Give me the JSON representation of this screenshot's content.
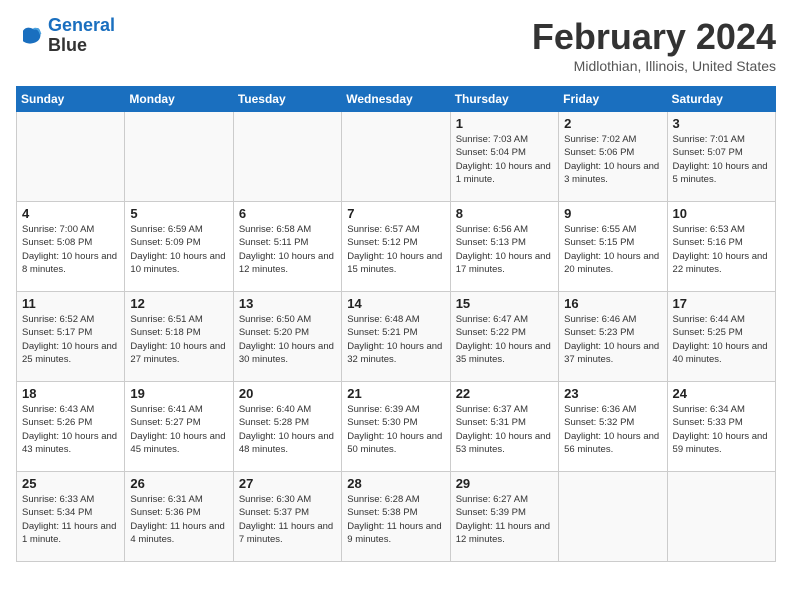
{
  "header": {
    "logo_line1": "General",
    "logo_line2": "Blue",
    "title": "February 2024",
    "subtitle": "Midlothian, Illinois, United States"
  },
  "weekdays": [
    "Sunday",
    "Monday",
    "Tuesday",
    "Wednesday",
    "Thursday",
    "Friday",
    "Saturday"
  ],
  "weeks": [
    [
      {
        "num": "",
        "detail": ""
      },
      {
        "num": "",
        "detail": ""
      },
      {
        "num": "",
        "detail": ""
      },
      {
        "num": "",
        "detail": ""
      },
      {
        "num": "1",
        "detail": "Sunrise: 7:03 AM\nSunset: 5:04 PM\nDaylight: 10 hours\nand 1 minute."
      },
      {
        "num": "2",
        "detail": "Sunrise: 7:02 AM\nSunset: 5:06 PM\nDaylight: 10 hours\nand 3 minutes."
      },
      {
        "num": "3",
        "detail": "Sunrise: 7:01 AM\nSunset: 5:07 PM\nDaylight: 10 hours\nand 5 minutes."
      }
    ],
    [
      {
        "num": "4",
        "detail": "Sunrise: 7:00 AM\nSunset: 5:08 PM\nDaylight: 10 hours\nand 8 minutes."
      },
      {
        "num": "5",
        "detail": "Sunrise: 6:59 AM\nSunset: 5:09 PM\nDaylight: 10 hours\nand 10 minutes."
      },
      {
        "num": "6",
        "detail": "Sunrise: 6:58 AM\nSunset: 5:11 PM\nDaylight: 10 hours\nand 12 minutes."
      },
      {
        "num": "7",
        "detail": "Sunrise: 6:57 AM\nSunset: 5:12 PM\nDaylight: 10 hours\nand 15 minutes."
      },
      {
        "num": "8",
        "detail": "Sunrise: 6:56 AM\nSunset: 5:13 PM\nDaylight: 10 hours\nand 17 minutes."
      },
      {
        "num": "9",
        "detail": "Sunrise: 6:55 AM\nSunset: 5:15 PM\nDaylight: 10 hours\nand 20 minutes."
      },
      {
        "num": "10",
        "detail": "Sunrise: 6:53 AM\nSunset: 5:16 PM\nDaylight: 10 hours\nand 22 minutes."
      }
    ],
    [
      {
        "num": "11",
        "detail": "Sunrise: 6:52 AM\nSunset: 5:17 PM\nDaylight: 10 hours\nand 25 minutes."
      },
      {
        "num": "12",
        "detail": "Sunrise: 6:51 AM\nSunset: 5:18 PM\nDaylight: 10 hours\nand 27 minutes."
      },
      {
        "num": "13",
        "detail": "Sunrise: 6:50 AM\nSunset: 5:20 PM\nDaylight: 10 hours\nand 30 minutes."
      },
      {
        "num": "14",
        "detail": "Sunrise: 6:48 AM\nSunset: 5:21 PM\nDaylight: 10 hours\nand 32 minutes."
      },
      {
        "num": "15",
        "detail": "Sunrise: 6:47 AM\nSunset: 5:22 PM\nDaylight: 10 hours\nand 35 minutes."
      },
      {
        "num": "16",
        "detail": "Sunrise: 6:46 AM\nSunset: 5:23 PM\nDaylight: 10 hours\nand 37 minutes."
      },
      {
        "num": "17",
        "detail": "Sunrise: 6:44 AM\nSunset: 5:25 PM\nDaylight: 10 hours\nand 40 minutes."
      }
    ],
    [
      {
        "num": "18",
        "detail": "Sunrise: 6:43 AM\nSunset: 5:26 PM\nDaylight: 10 hours\nand 43 minutes."
      },
      {
        "num": "19",
        "detail": "Sunrise: 6:41 AM\nSunset: 5:27 PM\nDaylight: 10 hours\nand 45 minutes."
      },
      {
        "num": "20",
        "detail": "Sunrise: 6:40 AM\nSunset: 5:28 PM\nDaylight: 10 hours\nand 48 minutes."
      },
      {
        "num": "21",
        "detail": "Sunrise: 6:39 AM\nSunset: 5:30 PM\nDaylight: 10 hours\nand 50 minutes."
      },
      {
        "num": "22",
        "detail": "Sunrise: 6:37 AM\nSunset: 5:31 PM\nDaylight: 10 hours\nand 53 minutes."
      },
      {
        "num": "23",
        "detail": "Sunrise: 6:36 AM\nSunset: 5:32 PM\nDaylight: 10 hours\nand 56 minutes."
      },
      {
        "num": "24",
        "detail": "Sunrise: 6:34 AM\nSunset: 5:33 PM\nDaylight: 10 hours\nand 59 minutes."
      }
    ],
    [
      {
        "num": "25",
        "detail": "Sunrise: 6:33 AM\nSunset: 5:34 PM\nDaylight: 11 hours\nand 1 minute."
      },
      {
        "num": "26",
        "detail": "Sunrise: 6:31 AM\nSunset: 5:36 PM\nDaylight: 11 hours\nand 4 minutes."
      },
      {
        "num": "27",
        "detail": "Sunrise: 6:30 AM\nSunset: 5:37 PM\nDaylight: 11 hours\nand 7 minutes."
      },
      {
        "num": "28",
        "detail": "Sunrise: 6:28 AM\nSunset: 5:38 PM\nDaylight: 11 hours\nand 9 minutes."
      },
      {
        "num": "29",
        "detail": "Sunrise: 6:27 AM\nSunset: 5:39 PM\nDaylight: 11 hours\nand 12 minutes."
      },
      {
        "num": "",
        "detail": ""
      },
      {
        "num": "",
        "detail": ""
      }
    ]
  ]
}
